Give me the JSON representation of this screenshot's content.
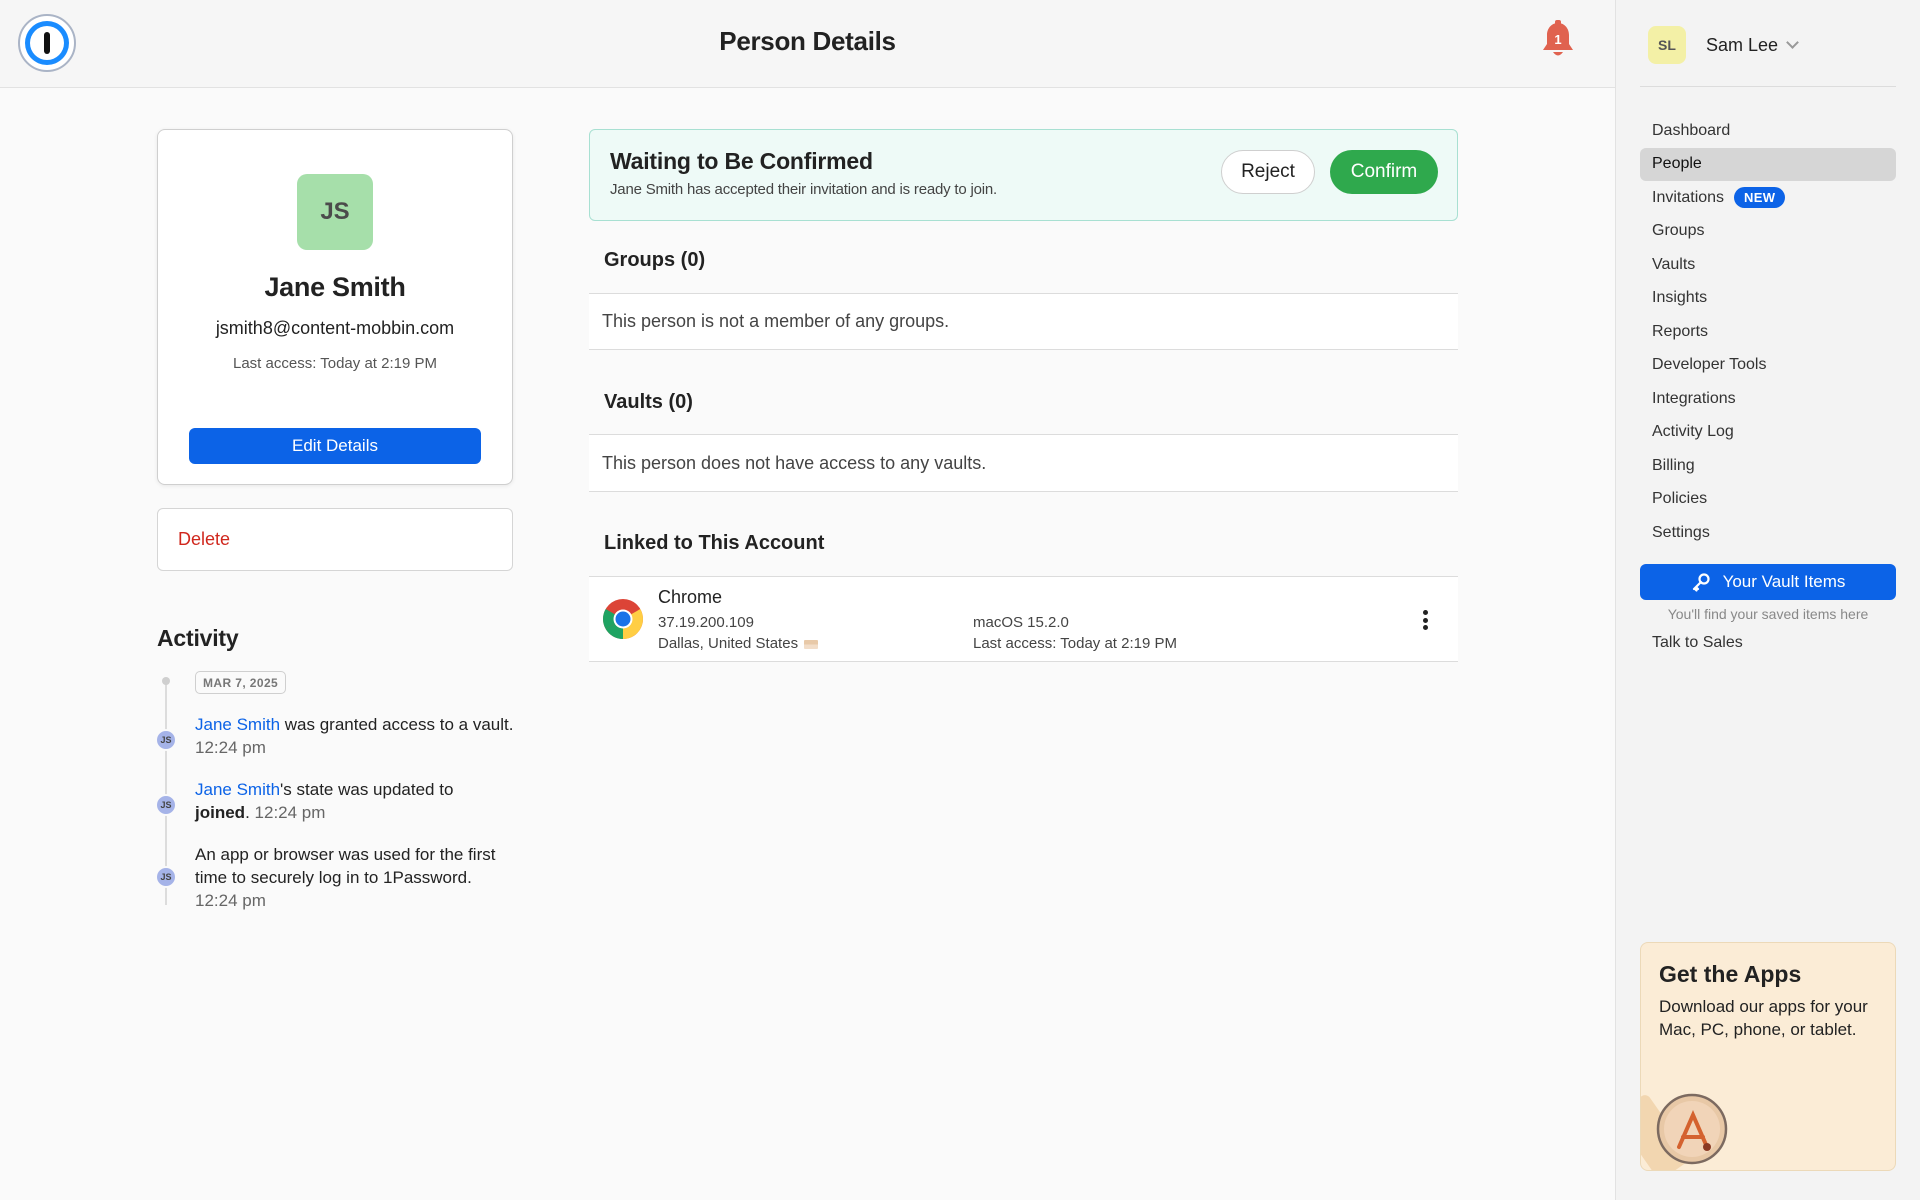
{
  "header": {
    "title": "Person Details",
    "notification_count": "1"
  },
  "user": {
    "initials": "SL",
    "name": "Sam Lee"
  },
  "sidebar": {
    "items": [
      {
        "label": "Dashboard",
        "active": false
      },
      {
        "label": "People",
        "active": true
      },
      {
        "label": "Invitations",
        "active": false,
        "badge": "NEW"
      },
      {
        "label": "Groups",
        "active": false
      },
      {
        "label": "Vaults",
        "active": false
      },
      {
        "label": "Insights",
        "active": false
      },
      {
        "label": "Reports",
        "active": false
      },
      {
        "label": "Developer Tools",
        "active": false
      },
      {
        "label": "Integrations",
        "active": false
      },
      {
        "label": "Activity Log",
        "active": false
      },
      {
        "label": "Billing",
        "active": false
      },
      {
        "label": "Policies",
        "active": false
      },
      {
        "label": "Settings",
        "active": false
      }
    ],
    "vault_button": "Your Vault Items",
    "vault_hint": "You'll find your saved items here",
    "talk_to_sales": "Talk to Sales",
    "apps_card": {
      "title": "Get the Apps",
      "description": "Download our apps for your Mac, PC, phone, or tablet."
    }
  },
  "profile": {
    "initials": "JS",
    "name": "Jane Smith",
    "email": "jsmith8@content-mobbin.com",
    "last_access": "Last access: Today at 2:19 PM",
    "edit_button": "Edit Details",
    "delete_label": "Delete"
  },
  "activity": {
    "title": "Activity",
    "date": "MAR 7, 2025",
    "entries": [
      {
        "avatar": "JS",
        "actor": "Jane Smith",
        "text": " was granted access to a vault.",
        "time": "12:24 pm"
      },
      {
        "avatar": "JS",
        "actor": "Jane Smith",
        "text_before_bold": "'s state was updated to ",
        "bold": "joined",
        "text_after_bold": ".",
        "time": "12:24 pm"
      },
      {
        "avatar": "JS",
        "text": "An app or browser was used for the first time to securely log in to 1Password.",
        "time": "12:24 pm"
      }
    ]
  },
  "confirmation": {
    "title": "Waiting to Be Confirmed",
    "subtitle": "Jane Smith has accepted their invitation and is ready to join.",
    "reject_label": "Reject",
    "confirm_label": "Confirm"
  },
  "groups": {
    "title": "Groups (0)",
    "empty_text": "This person is not a member of any groups."
  },
  "vaults": {
    "title": "Vaults (0)",
    "empty_text": "This person does not have access to any vaults."
  },
  "linked": {
    "title": "Linked to This Account",
    "device": {
      "browser": "Chrome",
      "ip": "37.19.200.109",
      "location": "Dallas, United States",
      "os": "macOS 15.2.0",
      "last_access": "Last access: Today at 2:19 PM"
    }
  },
  "colors": {
    "primary": "#0c63e7",
    "confirm_green": "#2fa94d",
    "danger": "#d0271d",
    "banner_bg": "#eefaf7"
  }
}
